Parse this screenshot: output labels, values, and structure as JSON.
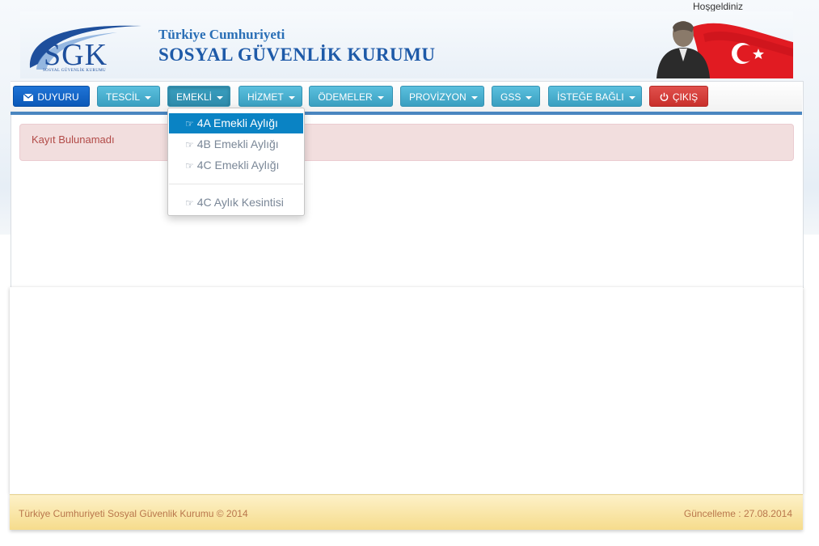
{
  "header": {
    "welcome": "Hoşgeldiniz",
    "logo_text": "SGK",
    "logo_subtitle": "SOSYAL GÜVENLİK KURUMU",
    "brand_line1": "Türkiye Cumhuriyeti",
    "brand_line2": "SOSYAL GÜVENLİK KURUMU"
  },
  "nav": {
    "duyuru": "DUYURU",
    "tescil": "TESCİL",
    "emekli": "EMEKLİ",
    "hizmet": "HİZMET",
    "odemeler": "ÖDEMELER",
    "provizyon": "PROVİZYON",
    "gss": "GSS",
    "istege_bagli": "İSTEĞE BAĞLI",
    "cikis": "ÇIKIŞ"
  },
  "emekli_menu": {
    "items": [
      {
        "label": "4A Emekli Aylığı"
      },
      {
        "label": "4B Emekli Aylığı"
      },
      {
        "label": "4C Emekli Aylığı"
      },
      {
        "label": "4C Aylık Kesintisi"
      }
    ]
  },
  "alert": {
    "text": "Kayıt Bulunamadı"
  },
  "footer": {
    "left": "Türkiye Cumhuriyeti Sosyal Güvenlik Kurumu © 2014",
    "right": "Güncelleme : 27.08.2014"
  },
  "colors": {
    "primary": "#0b58b8",
    "info": "#5bc0de",
    "danger": "#c9302c",
    "menu_active": "#0a83c4",
    "alert_bg": "#f2dede",
    "footer_bg": "#f6dc8c"
  },
  "icons": {
    "duyuru": "envelope-icon",
    "cikis": "power-icon",
    "menu_item": "hand-pointer-icon"
  }
}
